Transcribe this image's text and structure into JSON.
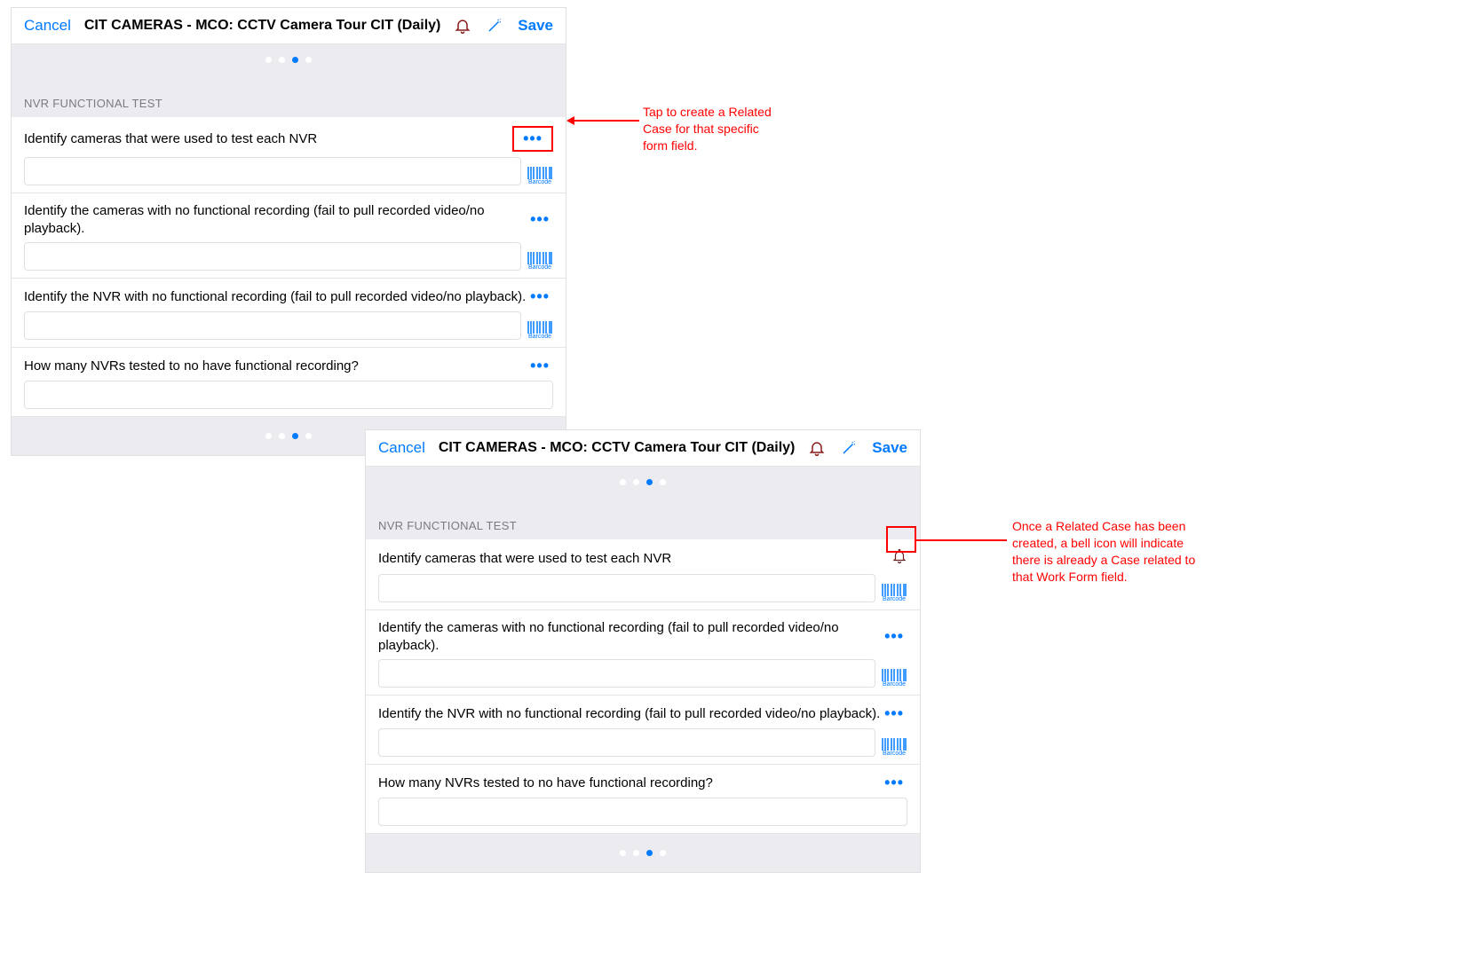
{
  "panel1": {
    "cancel": "Cancel",
    "title": "CIT CAMERAS - MCO: CCTV Camera Tour CIT (Daily)",
    "save": "Save",
    "section": "NVR FUNCTIONAL TEST",
    "fields": [
      {
        "label": "Identify cameras that were used to test each NVR",
        "barcode": true,
        "action": "dots"
      },
      {
        "label": "Identify the cameras with no functional recording (fail to pull recorded video/no playback).",
        "barcode": true,
        "action": "dots"
      },
      {
        "label": "Identify the NVR with no functional recording (fail to pull recorded video/no playback).",
        "barcode": true,
        "action": "dots"
      },
      {
        "label": "How many NVRs tested to no have functional recording?",
        "barcode": false,
        "action": "dots"
      }
    ]
  },
  "panel2": {
    "cancel": "Cancel",
    "title": "CIT CAMERAS - MCO: CCTV Camera Tour CIT (Daily)",
    "save": "Save",
    "section": "NVR FUNCTIONAL TEST",
    "fields": [
      {
        "label": "Identify cameras that were used to test each NVR",
        "barcode": true,
        "action": "bell"
      },
      {
        "label": "Identify the cameras with no functional recording (fail to pull recorded video/no playback).",
        "barcode": true,
        "action": "dots"
      },
      {
        "label": "Identify the NVR with no functional recording (fail to pull recorded video/no playback).",
        "barcode": true,
        "action": "dots"
      },
      {
        "label": "How many NVRs tested to no have functional recording?",
        "barcode": false,
        "action": "dots"
      }
    ]
  },
  "callouts": {
    "c1": "Tap to create a Related Case for that specific form field.",
    "c2": "Once a Related Case has been created, a bell icon will indicate there is already a Case related to that Work Form field."
  },
  "barcode_text": "Barcode"
}
